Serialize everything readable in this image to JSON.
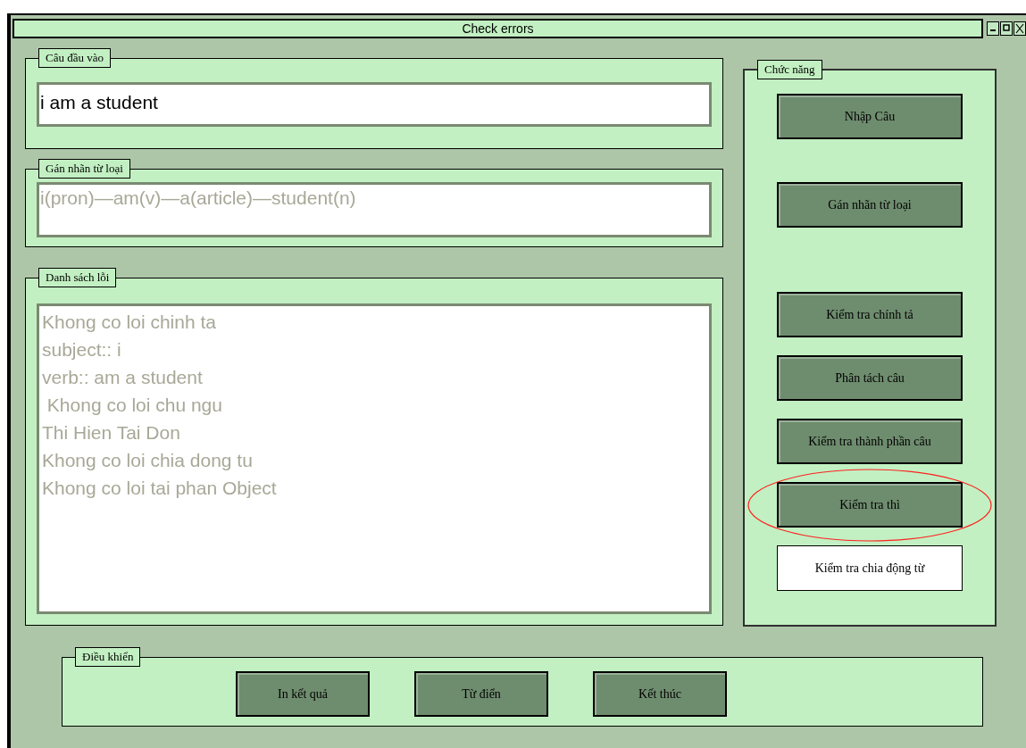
{
  "window": {
    "title": "Check errors"
  },
  "input_group": {
    "label": "Câu đầu vào",
    "value": "i am a student",
    "readonly": false
  },
  "tagging_group": {
    "label": "Gán nhãn từ loại",
    "value": "i(pron)—am(v)—a(article)—student(n)",
    "readonly": true
  },
  "errors_group": {
    "label": "Danh sách lỗi",
    "readonly": true,
    "lines": [
      "Khong co loi chinh ta",
      "subject:: i",
      "verb:: am a student",
      " Khong co loi chu ngu",
      "Thi Hien Tai Don",
      "Khong co loi chia dong tu",
      "Khong co loi tai phan Object"
    ]
  },
  "functions": {
    "label": "Chức năng",
    "buttons": [
      {
        "label": "Nhập Câu",
        "kind": "raised",
        "highlighted": false
      },
      {
        "label": "Gán nhãn từ loại",
        "kind": "raised",
        "highlighted": false
      },
      {
        "label": "Kiểm tra chính tả",
        "kind": "raised",
        "highlighted": false
      },
      {
        "label": "Phân tách câu",
        "kind": "raised",
        "highlighted": false
      },
      {
        "label": "Kiểm tra thành phần câu",
        "kind": "raised",
        "highlighted": false
      },
      {
        "label": "Kiểm tra thì",
        "kind": "raised",
        "highlighted": true
      },
      {
        "label": "Kiểm tra chia động từ",
        "kind": "flat",
        "highlighted": false
      }
    ]
  },
  "controls": {
    "label": "Điều khiển",
    "buttons": [
      "In kết quả",
      "Từ điển",
      "Kết thúc"
    ]
  }
}
